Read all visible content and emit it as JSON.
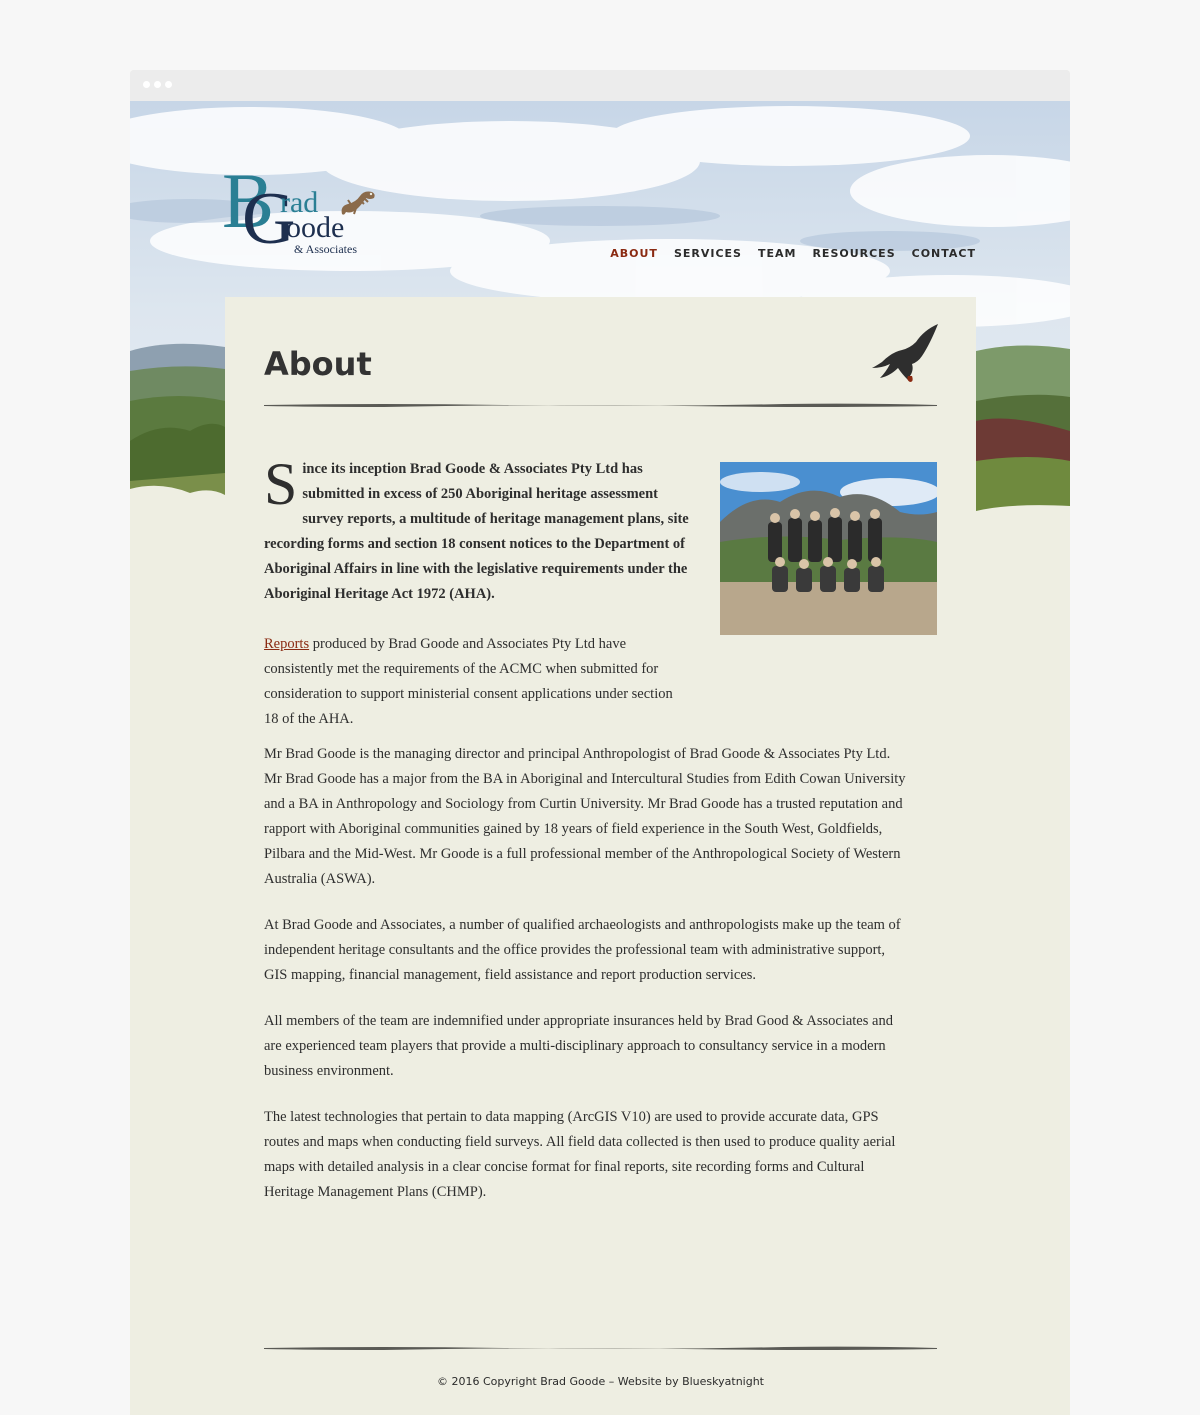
{
  "logo": {
    "letter_b": "B",
    "letter_g": "G",
    "word_brad": "rad",
    "word_goode": "oode",
    "subtitle": "& Associates"
  },
  "nav": {
    "items": [
      {
        "label": "ABOUT",
        "active": true
      },
      {
        "label": "SERVICES",
        "active": false
      },
      {
        "label": "TEAM",
        "active": false
      },
      {
        "label": "RESOURCES",
        "active": false
      },
      {
        "label": "CONTACT",
        "active": false
      }
    ]
  },
  "page": {
    "title": "About",
    "intro_dropcap": "S",
    "intro_rest": "ince its inception Brad Goode & Associates Pty Ltd has submitted in excess of 250 Aboriginal heritage assessment survey reports, a multitude of heritage management plans, site recording forms and section 18 consent notices to the Department of Aboriginal Affairs in line with the legislative requirements under the Aboriginal Heritage Act 1972 (AHA).",
    "reports_link": "Reports",
    "reports_rest": " produced by Brad Goode and Associates Pty Ltd have consistently met the requirements of the ACMC when submitted for consideration to support ministerial consent applications under section 18 of the AHA.",
    "paragraphs": [
      "Mr Brad Goode is the managing director and principal Anthropologist of Brad Goode & Associates Pty Ltd. Mr Brad Goode has a major from the BA in Aboriginal and Intercultural Studies from Edith Cowan University and a BA in Anthropology and Sociology from Curtin University. Mr Brad Goode has a trusted reputation and rapport with Aboriginal communities gained by 18 years of field experience in the South West, Goldfields, Pilbara and the Mid-West. Mr Goode is a full professional member of the Anthropological Society of Western Australia (ASWA).",
      "At Brad Goode and Associates, a number of qualified archaeologists and anthropologists make up the team of independent heritage consultants and the office provides the professional team with administrative support, GIS mapping, financial management, field assistance and report production services.",
      "All members of the team are indemnified under appropriate insurances held by Brad Good & Associates and are experienced team players that provide a multi-disciplinary approach to consultancy service in a modern business environment.",
      "The latest technologies that pertain to data mapping (ArcGIS V10) are used to provide accurate data, GPS routes and maps when conducting field surveys. All field data collected is then used to produce quality aerial maps with detailed analysis in a clear concise format for final reports, site recording forms and Cultural Heritage Management Plans (CHMP)."
    ]
  },
  "footer": {
    "text": "© 2016 Copyright Brad Goode – Website by Blueskyatnight"
  },
  "colors": {
    "accent": "#8a2a12",
    "logo_teal": "#2a7f94",
    "logo_navy": "#1d2f4f",
    "panel": "#eeeee2"
  }
}
